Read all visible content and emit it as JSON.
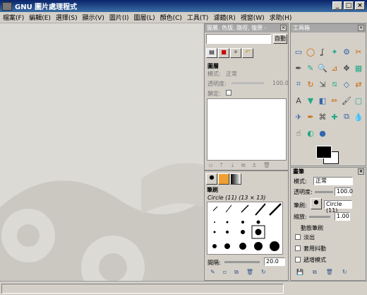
{
  "window": {
    "title": "GNU 圖片處理程式"
  },
  "menu": [
    "檔案(F)",
    "編輯(E)",
    "選擇(S)",
    "顯示(V)",
    "圖片(I)",
    "圖層(L)",
    "顏色(C)",
    "工具(T)",
    "濾鏡(R)",
    "視窗(W)",
    "求助(H)"
  ],
  "layers_dock": {
    "title": "圖層, 色版, 路徑, 復原 -",
    "auto_button": "自動",
    "panel_title": "圖層",
    "mode_label": "模式:",
    "mode_value": "正常",
    "opacity_label": "透明度:",
    "opacity_value": "100.0",
    "lock_label": "鎖定:"
  },
  "brushes_dock": {
    "title": "筆刷",
    "brush_name": "Circle (11) (13 × 13)",
    "spacing_label": "間隔:",
    "spacing_value": "20.0"
  },
  "toolbox": {
    "title": "工具箱",
    "tools": [
      "rect-select",
      "ellipse-select",
      "free-select",
      "fuzzy-select",
      "select-by-color",
      "scissors",
      "paths",
      "color-picker",
      "zoom",
      "measure",
      "move",
      "align",
      "crop",
      "rotate",
      "scale",
      "shear",
      "perspective",
      "flip",
      "text",
      "bucket-fill",
      "blend",
      "pencil",
      "paintbrush",
      "eraser",
      "airbrush",
      "ink",
      "clone",
      "heal",
      "perspective-clone",
      "blur",
      "smudge",
      "dodge",
      "burn"
    ],
    "colors": {
      "fg": "#000000",
      "bg": "#ffffff"
    }
  },
  "tool_options": {
    "title": "畫筆",
    "mode_label": "模式:",
    "mode_value": "正常",
    "opacity_label": "透明度:",
    "opacity_value": "100.0",
    "brush_label": "筆刷:",
    "brush_value": "Circle (11)",
    "scale_label": "縮放:",
    "scale_value": "1.00",
    "dynamics_label": "動態筆刷",
    "fade_label": "淡出",
    "jitter_label": "套用抖動",
    "incremental_label": "遞增模式"
  }
}
